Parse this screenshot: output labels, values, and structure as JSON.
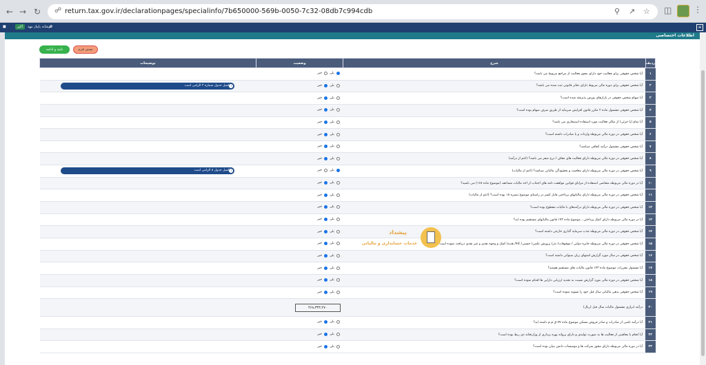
{
  "browser": {
    "url": "return.tax.gov.ir/declarationpages/specialinfo/7b650000-569b-0050-7c32-08db7c994cdb"
  },
  "bookmarks": {
    "badge": "اکبر",
    "item": "کوشانه پاپیاز مهد"
  },
  "section": {
    "title": "اطلاعات اختصاصی"
  },
  "buttons": {
    "green": "تایید و ادامه",
    "orange": "بستن فرم"
  },
  "table": {
    "headers": {
      "num": "ردیف",
      "desc": "شرح",
      "status": "وضعیت",
      "exp": "توضیحات"
    },
    "yes": "بلی",
    "no": "خیر",
    "rows": [
      {
        "n": "۱",
        "q": "آیا شخص حقوقی برای فعالیت خود دارای مجوز فعالیت از مراجع مربوط می باشد؟",
        "sel": "yes"
      },
      {
        "n": "۲",
        "q": "آیا شخص حقوقی برای دوره مالی مربوط دارای دفاتر قانونی ثبت شده می باشد؟",
        "sel": "no",
        "note": "تکمیل جدول شماره ۳ الزامی است"
      },
      {
        "n": "۳",
        "q": "آیا سهام شخص حقوقی در بازارهای بورس پذیرفته شده است؟",
        "sel": "no"
      },
      {
        "n": "۴",
        "q": "آیا شخص حقوقی مشمول ماده ۲ مکرر قانون افزایش سرمایه از طریق صرف سهام بوده است؟",
        "sel": "no"
      },
      {
        "n": "۵",
        "q": "آیا تمام (یا جزئی) از مکان فعالیت مورد استفاده استیجاری می باشد؟",
        "sel": "no"
      },
      {
        "n": "۶",
        "q": "آیا شخص حقوقی در دوره مالی مربوطه واردات و یا صادرات داشته است؟",
        "sel": "no"
      },
      {
        "n": "۷",
        "q": "آیا شخص حقوقی مشمول درآمد اتفاقی میباشد؟",
        "sel": "no"
      },
      {
        "n": "۸",
        "q": "آیا شخص حقوقی در دوره مالی مربوطه دارای فعالیت های معاف / نرخ صفر می باشد؟ (اعم از درآمد)",
        "sel": "no"
      },
      {
        "n": "۹",
        "q": "آیا شخص حقوقی در دوره مالی مربوطه دارای معافیت و بخشودگی مالیاتی میباشد؟ (اعم از مالیات)",
        "sel": "yes",
        "note": "تکمیل جدول ۸ الزامی است"
      },
      {
        "n": "۱۰",
        "q": "آیا در دوره مالی مربوطه متقاضی استفاده از مزایای قوانین موافقت نامه های اجتناب از اخذ مالیات مضاعف (موضوع ماده ۱۶۸) می باشید؟",
        "sel": "no"
      },
      {
        "n": "۱۱",
        "q": "آیا شخص حقوقی در دوره مالی مربوطه دارای مالیاتهای پرداختی قابل کسر در راستای موضوع تبصره ۱۸ بوده است؟ (اعم از مالیات)",
        "sel": "no"
      },
      {
        "n": "۱۲",
        "q": "آیا شخص حقوقی در دوره مالی مربوطه دارای درآمدهای با مالیات مقطوع بوده است؟",
        "sel": "no"
      },
      {
        "n": "۱۳",
        "q": "آیا در دوره مالی مربوطه دارای کمک پرداختی ، موضوع ماده ۱۷۲ قانون مالیاتهای مستقیم بوده اید؟",
        "sel": "no"
      },
      {
        "n": "۱۴",
        "q": "آیا شخص حقوقی در دوره مالی مربوطه جذب سرمایه گذاری خارجی داشته است؟",
        "sel": "no"
      },
      {
        "n": "۱۵",
        "q": "آیا شخص حقوقی در دوره مالی مربوطه جایزه دولتی / موقوفات/ نذر/ پرورش علمی/ حسنی/ کالا/ هدیه/ کمک و وجوه نقدی و غیر نقدی دریافت نموده است؟",
        "sel": "no"
      },
      {
        "n": "۱۶",
        "q": "آیا شخص حقوقی در سال مورد گزارش اشتهای زیان سنواتی داشته است؟",
        "sel": "no"
      },
      {
        "n": "۱۷",
        "q": "آیا مشمول مقررات موضوع ماده ۱۴۳ قانون مالیات های مستقیم هستید؟",
        "sel": "no"
      },
      {
        "n": "۱۸",
        "q": "آیا شخص حقوقی در دوره مالی مورد گزارش نسبت به تجدید ارزیابی دارایی ها اقدام نموده است؟",
        "sel": "no"
      },
      {
        "n": "۱۹",
        "q": "آیا شخص حقوقی بدهی مالیاتی سال قبل خود را تسویه نموده است؟",
        "sel": "no"
      },
      {
        "n": "۲۰",
        "q": "درآمد ابرازی مشمول مالیات سال قبل (ریال)",
        "amount": "۴۶۸،۳۳۳،۲۷۰"
      },
      {
        "n": "۲۱",
        "q": "آیا درآمد ناشی از صادرات و صادر فروش مسکن موضوع ماده ۷۷ ق م م داشته اید؟",
        "sel": "no"
      },
      {
        "n": "۲۲",
        "q": "آیا انجام یا معافیتی از فعالیت ها به صورت تولیدی و دارای پروانه بهره برداری از وزارتخانه ذی ربط بوده است؟",
        "sel": "no"
      },
      {
        "n": "۲۳",
        "q": "آیا در دوره مالی مربوطه دارای مجوز شرکت ها و موسسات دانش بنیان بوده است؟",
        "sel": "no"
      }
    ]
  },
  "watermark": {
    "title": "پیشداد",
    "subtitle": "خدمات حسابداری و مالیاتی"
  }
}
